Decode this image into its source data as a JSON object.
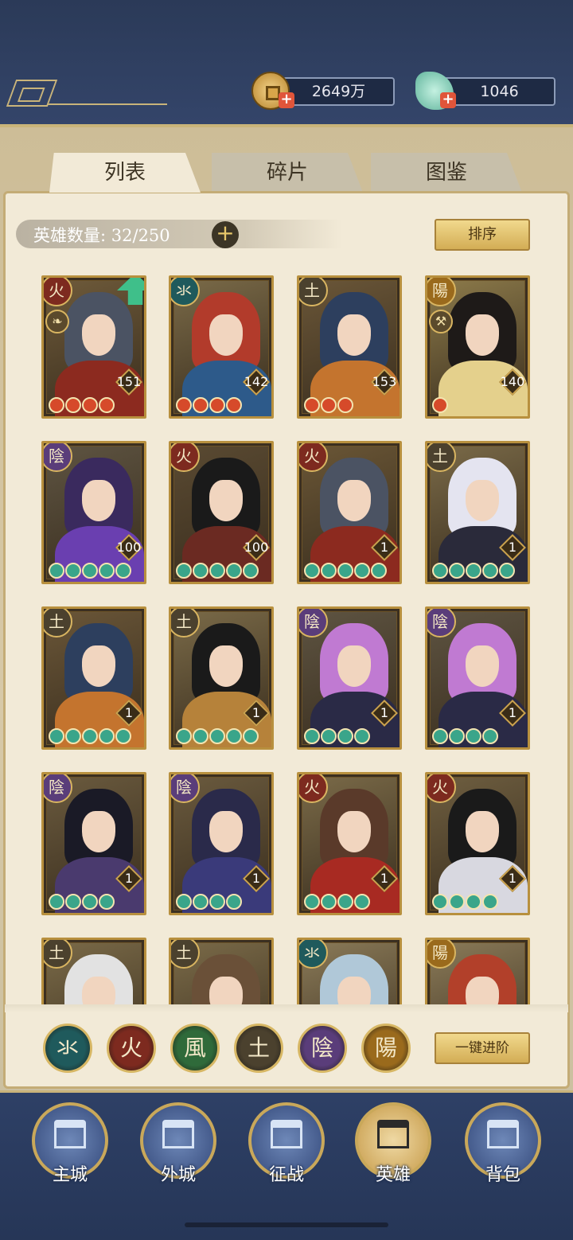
{
  "resources": {
    "coins": "2649万",
    "jade": "1046"
  },
  "tabs": [
    "列表",
    "碎片",
    "图鉴"
  ],
  "hero_count": {
    "label": "英雄数量:",
    "value": "32/250"
  },
  "sort_label": "排序",
  "upgrade_label": "一键进阶",
  "element_colors": {
    "water": "#1f5a5c",
    "fire": "#7d2a1f",
    "wind": "#2f6a3a",
    "earth": "#4b412e",
    "yin": "#5a3d7a",
    "yang": "#9a6a1c"
  },
  "element_glyphs": {
    "water": "氺",
    "fire": "火",
    "wind": "風",
    "earth": "土",
    "yin": "陰",
    "yang": "陽"
  },
  "heroes": [
    {
      "element": "fire",
      "level": "151",
      "stars": 4,
      "star_color": "red",
      "hair": "#4b5363",
      "outfit": "#8c2a1f",
      "bg": "#6e5a3a",
      "upgrade_arrow": true,
      "side_icon": "leaf"
    },
    {
      "element": "water",
      "level": "142",
      "stars": 4,
      "star_color": "red",
      "hair": "#b23b2b",
      "outfit": "#2d5a8a",
      "bg": "#7a6a48"
    },
    {
      "element": "earth",
      "level": "153",
      "stars": 3,
      "star_color": "red",
      "hair": "#2d3f5e",
      "outfit": "#c4742e",
      "bg": "#6a5638"
    },
    {
      "element": "yang",
      "level": "140",
      "stars": 1,
      "star_color": "red",
      "hair": "#1e1a18",
      "outfit": "#e4d08c",
      "bg": "#8c7a4a",
      "side_icon": "hammer"
    },
    {
      "element": "yin",
      "level": "100",
      "stars": 5,
      "star_color": "green",
      "hair": "#3a2a5e",
      "outfit": "#6a3fb0",
      "bg": "#5e5442"
    },
    {
      "element": "fire",
      "level": "100",
      "stars": 5,
      "star_color": "green",
      "hair": "#1a1a1a",
      "outfit": "#6b2a22",
      "bg": "#5a4a32"
    },
    {
      "element": "fire",
      "level": "1",
      "stars": 5,
      "star_color": "green",
      "hair": "#4b5363",
      "outfit": "#8c2a1f",
      "bg": "#6a5636"
    },
    {
      "element": "earth",
      "level": "1",
      "stars": 5,
      "star_color": "green",
      "hair": "#e4e4f0",
      "outfit": "#2a2a3a",
      "bg": "#7a6a48"
    },
    {
      "element": "earth",
      "level": "1",
      "stars": 5,
      "star_color": "green",
      "hair": "#2d3f5e",
      "outfit": "#c4742e",
      "bg": "#6a5638"
    },
    {
      "element": "earth",
      "level": "1",
      "stars": 5,
      "star_color": "green",
      "hair": "#1a1a1a",
      "outfit": "#b6823a",
      "bg": "#7a6a48"
    },
    {
      "element": "yin",
      "level": "1",
      "stars": 4,
      "star_color": "green",
      "hair": "#c07ad2",
      "outfit": "#2a2a46",
      "bg": "#5e5442"
    },
    {
      "element": "yin",
      "level": "1",
      "stars": 4,
      "star_color": "green",
      "hair": "#c07ad2",
      "outfit": "#2a2a46",
      "bg": "#5e5442"
    },
    {
      "element": "yin",
      "level": "1",
      "stars": 4,
      "star_color": "green",
      "hair": "#1a1a26",
      "outfit": "#4a3a6e",
      "bg": "#6a5a3e"
    },
    {
      "element": "yin",
      "level": "1",
      "stars": 4,
      "star_color": "green",
      "hair": "#2a2a4a",
      "outfit": "#3a3a7a",
      "bg": "#6a5a3e"
    },
    {
      "element": "fire",
      "level": "1",
      "stars": 4,
      "star_color": "green",
      "hair": "#5a3a2a",
      "outfit": "#a82a22",
      "bg": "#7a6a48"
    },
    {
      "element": "fire",
      "level": "1",
      "stars": 4,
      "star_color": "green",
      "hair": "#1a1a1a",
      "outfit": "#d8d8e0",
      "bg": "#6e5e40"
    },
    {
      "element": "earth",
      "hair": "#e2e2e2",
      "outfit": "#6a5a48",
      "bg": "#7a6a48"
    },
    {
      "element": "earth",
      "hair": "#6a5038",
      "outfit": "#6a5a48",
      "bg": "#7a6a48"
    },
    {
      "element": "water",
      "hair": "#b0c8d8",
      "outfit": "#e8e8ee",
      "bg": "#8a7a58"
    },
    {
      "element": "yang",
      "hair": "#b2402a",
      "outfit": "#6a5a48",
      "bg": "#8a7a58"
    }
  ],
  "filters": [
    "water",
    "fire",
    "wind",
    "earth",
    "yin",
    "yang"
  ],
  "nav": [
    {
      "key": "main-city",
      "label": "主城",
      "active": false
    },
    {
      "key": "outer-city",
      "label": "外城",
      "active": false
    },
    {
      "key": "campaign",
      "label": "征战",
      "active": false
    },
    {
      "key": "heroes",
      "label": "英雄",
      "active": true
    },
    {
      "key": "bag",
      "label": "背包",
      "active": false
    }
  ]
}
